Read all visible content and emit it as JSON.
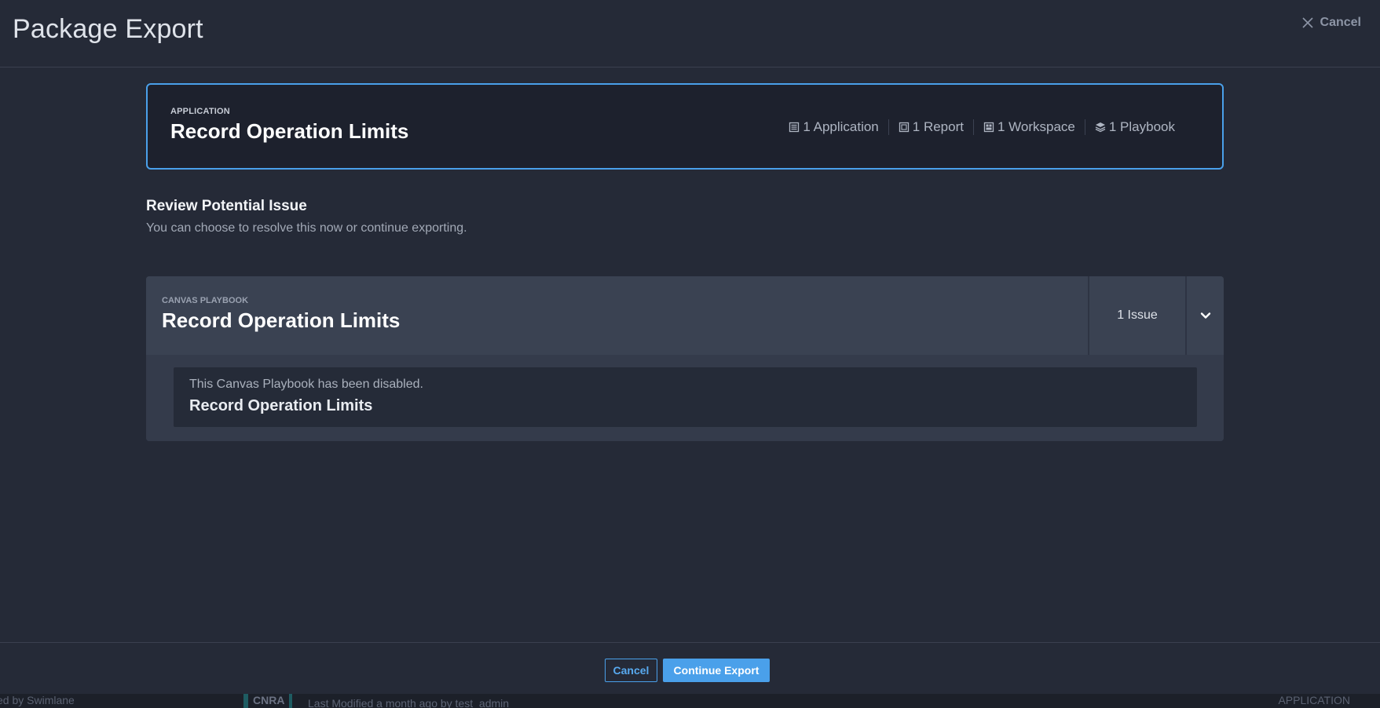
{
  "header": {
    "title": "Package Export",
    "cancel_label": "Cancel"
  },
  "app_card": {
    "kicker": "APPLICATION",
    "title": "Record Operation Limits",
    "counts": [
      {
        "icon": "application-icon",
        "label": "1 Application"
      },
      {
        "icon": "report-icon",
        "label": "1 Report"
      },
      {
        "icon": "workspace-icon",
        "label": "1 Workspace"
      },
      {
        "icon": "playbook-icon",
        "label": "1 Playbook"
      }
    ]
  },
  "review": {
    "title": "Review Potential Issue",
    "subtitle": "You can choose to resolve this now or continue exporting."
  },
  "issue_panel": {
    "kicker": "CANVAS PLAYBOOK",
    "title": "Record Operation Limits",
    "issue_count": "1 Issue",
    "item": {
      "message": "This Canvas Playbook has been disabled.",
      "title": "Record Operation Limits"
    }
  },
  "footer": {
    "cancel_label": "Cancel",
    "continue_label": "Continue Export"
  },
  "background": {
    "brand": "ed by Swimlane",
    "tag": "CNRA",
    "modified": "Last Modified a month ago by test_admin",
    "type": "APPLICATION"
  },
  "colors": {
    "accent": "#4aa0ea",
    "background": "#252a37",
    "card": "#1d212d",
    "panel": "#3a4252"
  }
}
